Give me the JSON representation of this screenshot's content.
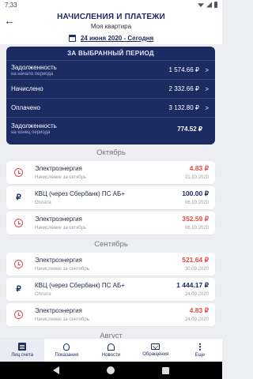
{
  "status_bar": {
    "time": "7:33"
  },
  "header": {
    "title": "НАЧИСЛЕНИЯ И ПЛАТЕЖИ",
    "subtitle": "Моя квартира",
    "period": "24 июня 2020 - Сегодня"
  },
  "summary": {
    "title": "ЗА ВЫБРАННЫЙ ПЕРИОД",
    "rows": [
      {
        "label": "Задолженность",
        "sublabel": "на начало периода",
        "value": "1 574.66 ₽"
      },
      {
        "label": "Начислено",
        "sublabel": "",
        "value": "2 332.66 ₽"
      },
      {
        "label": "Оплачено",
        "sublabel": "",
        "value": "3 132.80 ₽"
      },
      {
        "label": "Задолженность",
        "sublabel": "на конец периода",
        "value": "774.52 ₽"
      }
    ]
  },
  "months": [
    {
      "name": "Октябрь",
      "items": [
        {
          "icon": "clock-icon",
          "name": "Электроэнергия",
          "note": "Начисление за октябрь",
          "amount": "4.83 ₽",
          "date": "21.10.2020",
          "type": "charge"
        },
        {
          "icon": "ruble-icon",
          "name": "КВЦ (через Сбербанк) ПС АБ+",
          "note": "Оплата",
          "amount": "100.00 ₽",
          "date": "06.10.2020",
          "type": "pay"
        },
        {
          "icon": "clock-icon",
          "name": "Электроэнергия",
          "note": "Начисление за октябрь",
          "amount": "352.59 ₽",
          "date": "06.10.2020",
          "type": "charge"
        }
      ]
    },
    {
      "name": "Сентябрь",
      "items": [
        {
          "icon": "clock-icon",
          "name": "Электроэнергия",
          "note": "Начисление за сентябрь",
          "amount": "521.64 ₽",
          "date": "30.09.2020",
          "type": "charge"
        },
        {
          "icon": "ruble-icon",
          "name": "КВЦ (через Сбербанк) ПС АБ+",
          "note": "Оплата",
          "amount": "1 444.17 ₽",
          "date": "24.09.2020",
          "type": "pay"
        },
        {
          "icon": "clock-icon",
          "name": "Электроэнергия",
          "note": "Начисление за сентябрь",
          "amount": "4.83 ₽",
          "date": "24.09.2020",
          "type": "charge"
        }
      ]
    },
    {
      "name": "Август",
      "items": []
    }
  ],
  "bottom_nav": [
    {
      "label": "Лиц.счета",
      "icon": "document-icon",
      "active": true
    },
    {
      "label": "Показания",
      "icon": "bulb-icon",
      "active": false
    },
    {
      "label": "Новости",
      "icon": "bell-icon",
      "active": false
    },
    {
      "label": "Обращения",
      "icon": "mail-icon",
      "active": false
    },
    {
      "label": "Еще",
      "icon": "more-icon",
      "active": false
    }
  ],
  "colors": {
    "primary": "#1d2b63",
    "charge": "#e34a4a",
    "background": "#eceef2"
  }
}
